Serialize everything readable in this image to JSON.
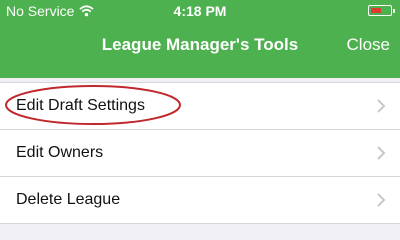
{
  "status_bar": {
    "carrier": "No Service",
    "time": "4:18 PM",
    "wifi_icon": "wifi-icon",
    "battery_icon": "battery-icon",
    "battery_color": "#e0392f"
  },
  "navbar": {
    "title": "League Manager's Tools",
    "close_label": "Close",
    "background_color": "#4cb14e"
  },
  "menu": {
    "items": [
      {
        "label": "Edit Draft Settings",
        "icon": "chevron-right-icon",
        "highlighted": true
      },
      {
        "label": "Edit Owners",
        "icon": "chevron-right-icon"
      },
      {
        "label": "Delete League",
        "icon": "chevron-right-icon"
      }
    ]
  },
  "annotation": {
    "highlight_color": "#c0282d"
  }
}
